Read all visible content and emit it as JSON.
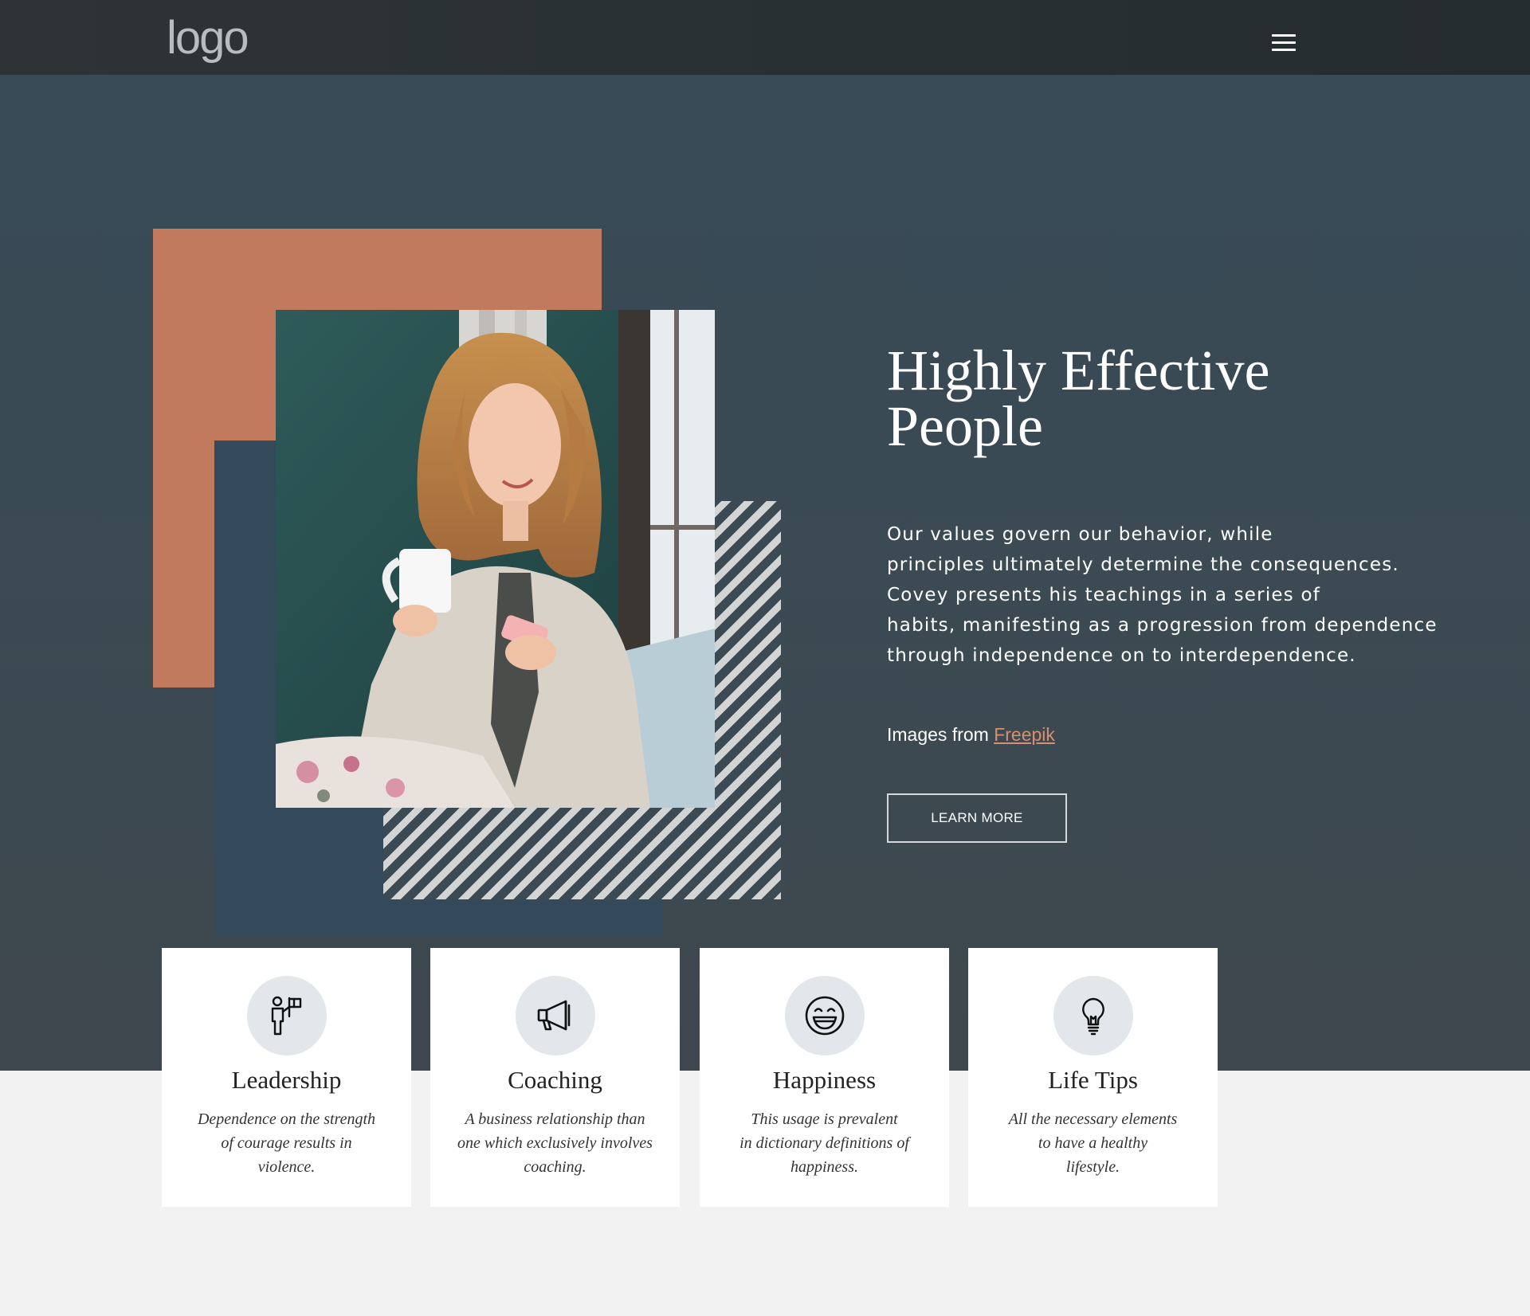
{
  "header": {
    "logo_text": "logo",
    "menu_icon": "hamburger-menu-icon"
  },
  "hero": {
    "title_line1": "Highly Effective",
    "title_line2": "People",
    "description_lines": [
      "Our values govern our behavior, while",
      "principles ultimately determine the consequences.",
      "Covey presents his teachings in a series of",
      "habits, manifesting as a progression from dependence",
      "through independence on to interdependence."
    ],
    "credit_prefix": "Images from ",
    "credit_link": "Freepik",
    "button_label": "LEARN MORE"
  },
  "colors": {
    "accent": "#c17a5e",
    "link": "#d88e70",
    "header_bg": "#2a3135",
    "hero_bg": "#3b4a53",
    "slate_block": "#34495a",
    "icon_circle": "#e3e7ec"
  },
  "cards": [
    {
      "icon": "leader-flag-icon",
      "title": "Leadership",
      "text_lines": [
        "Dependence on the strength",
        "of courage results in",
        "violence."
      ]
    },
    {
      "icon": "megaphone-icon",
      "title": "Coaching",
      "text_lines": [
        "A business relationship than",
        "one which exclusively involves",
        "coaching."
      ]
    },
    {
      "icon": "smiley-face-icon",
      "title": "Happiness",
      "text_lines": [
        "This usage is prevalent",
        "in dictionary definitions of",
        "happiness."
      ]
    },
    {
      "icon": "lightbulb-icon",
      "title": "Life Tips",
      "text_lines": [
        "All the necessary elements",
        "to have a healthy",
        "lifestyle."
      ]
    }
  ]
}
